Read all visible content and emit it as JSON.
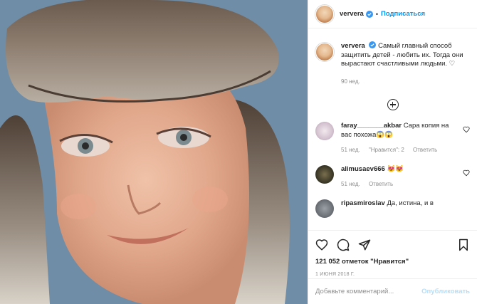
{
  "post": {
    "username": "ververa",
    "follow_label": "Подписаться",
    "caption": "Самый главный способ защитить детей - любить их. Тогда они вырастают счастливыми людьми. ♡",
    "caption_age": "90 нед."
  },
  "comments": [
    {
      "username": "faray_______akbar",
      "text": "Сара копия на вас похожа😱😱",
      "age": "51 нед.",
      "likes": "\"Нравится\": 2",
      "reply": "Ответить"
    },
    {
      "username": "alimusaev666",
      "text": "😻😻",
      "age": "51 нед.",
      "likes": "",
      "reply": "Ответить"
    },
    {
      "username": "ripasmiroslav",
      "text": "Да, истина, и в",
      "age": "",
      "likes": "",
      "reply": ""
    }
  ],
  "actions": {
    "likes_count": "121 052 отметок \"Нравится\"",
    "date": "1 ИЮНЯ 2018 Г."
  },
  "add_comment": {
    "placeholder": "Добавьте комментарий...",
    "publish_label": "Опубликовать"
  },
  "colors": {
    "accent": "#0095f6",
    "muted": "#8e8e8e"
  }
}
